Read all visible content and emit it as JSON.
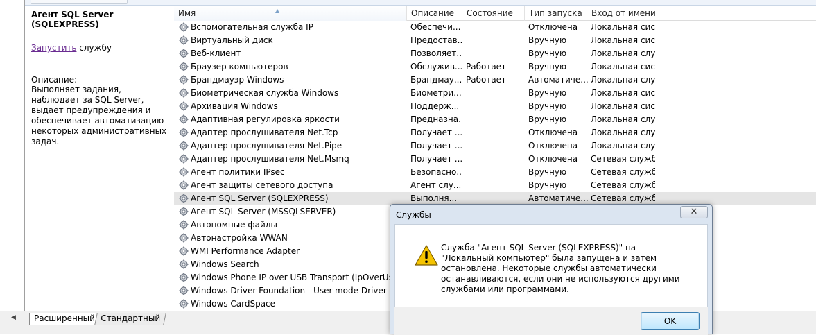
{
  "description_panel": {
    "title": "Агент SQL Server (SQLEXPRESS)",
    "action_link": "Запустить",
    "action_suffix": " службу",
    "description_label": "Описание:",
    "description_text": "Выполняет задания, наблюдает за SQL Server, выдает предупреждения и обеспечивает автоматизацию некоторых административных задач."
  },
  "columns": {
    "name": "Имя",
    "description": "Описание",
    "state": "Состояние",
    "startup_type": "Тип запуска",
    "logon_as": "Вход от имени"
  },
  "services": [
    {
      "name": "Вспомогательная служба IP",
      "description": "Обеспечи...",
      "state": "",
      "startup": "Отключена",
      "logon": "Локальная сис..."
    },
    {
      "name": "Виртуальный диск",
      "description": "Предостав...",
      "state": "",
      "startup": "Вручную",
      "logon": "Локальная сис..."
    },
    {
      "name": "Веб-клиент",
      "description": "Позволяет...",
      "state": "",
      "startup": "Вручную",
      "logon": "Локальная слу..."
    },
    {
      "name": "Браузер компьютеров",
      "description": "Обслужив...",
      "state": "Работает",
      "startup": "Вручную",
      "logon": "Локальная сис..."
    },
    {
      "name": "Брандмауэр Windows",
      "description": "Брандмау...",
      "state": "Работает",
      "startup": "Автоматиче...",
      "logon": "Локальная слу..."
    },
    {
      "name": "Биометрическая служба Windows",
      "description": "Биометри...",
      "state": "",
      "startup": "Вручную",
      "logon": "Локальная сис..."
    },
    {
      "name": "Архивация Windows",
      "description": "Поддерж...",
      "state": "",
      "startup": "Вручную",
      "logon": "Локальная сис..."
    },
    {
      "name": "Адаптивная регулировка яркости",
      "description": "Предназна...",
      "state": "",
      "startup": "Вручную",
      "logon": "Локальная слу..."
    },
    {
      "name": "Адаптер прослушивателя Net.Tcp",
      "description": "Получает ...",
      "state": "",
      "startup": "Отключена",
      "logon": "Локальная слу..."
    },
    {
      "name": "Адаптер прослушивателя Net.Pipe",
      "description": "Получает ...",
      "state": "",
      "startup": "Отключена",
      "logon": "Локальная слу..."
    },
    {
      "name": "Адаптер прослушивателя Net.Msmq",
      "description": "Получает ...",
      "state": "",
      "startup": "Отключена",
      "logon": "Сетевая служба"
    },
    {
      "name": "Агент политики IPsec",
      "description": "Безопасно...",
      "state": "",
      "startup": "Вручную",
      "logon": "Сетевая служба"
    },
    {
      "name": "Агент защиты сетевого доступа",
      "description": "Агент слу...",
      "state": "",
      "startup": "Вручную",
      "logon": "Сетевая служба"
    },
    {
      "name": "Агент SQL Server (SQLEXPRESS)",
      "description": "Выполня...",
      "state": "",
      "startup": "Автоматиче...",
      "logon": "Сетевая служба",
      "selected": true
    },
    {
      "name": "Агент SQL Server (MSSQLSERVER)",
      "description": "",
      "state": "",
      "startup": "",
      "logon": ""
    },
    {
      "name": "Автономные файлы",
      "description": "",
      "state": "",
      "startup": "",
      "logon": ""
    },
    {
      "name": "Автонастройка WWAN",
      "description": "",
      "state": "",
      "startup": "",
      "logon": ""
    },
    {
      "name": "WMI Performance Adapter",
      "description": "",
      "state": "",
      "startup": "",
      "logon": ""
    },
    {
      "name": "Windows Search",
      "description": "",
      "state": "",
      "startup": "",
      "logon": ""
    },
    {
      "name": "Windows Phone IP over USB Transport (IpOverUsbSvc)",
      "description": "",
      "state": "",
      "startup": "",
      "logon": ""
    },
    {
      "name": "Windows Driver Foundation - User-mode Driver Framework",
      "description": "",
      "state": "",
      "startup": "",
      "logon": ""
    },
    {
      "name": "Windows CardSpace",
      "description": "",
      "state": "",
      "startup": "",
      "logon": ""
    }
  ],
  "tabs": {
    "extended": "Расширенный",
    "standard": "Стандартный"
  },
  "dialog": {
    "title": "Службы",
    "close_glyph": "✕",
    "icon": "warning-icon",
    "message": "Служба \"Агент SQL Server (SQLEXPRESS)\" на \"Локальный компьютер\" была запущена и затем остановлена. Некоторые службы автоматически останавливаются, если они не используются другими службами или программами.",
    "ok_label": "OK"
  },
  "colors": {
    "link": "#6a2c91",
    "selected_row": "#e5e5e5",
    "dialog_frame": "#dbe5f1",
    "ok_button": "#bee6fd"
  }
}
